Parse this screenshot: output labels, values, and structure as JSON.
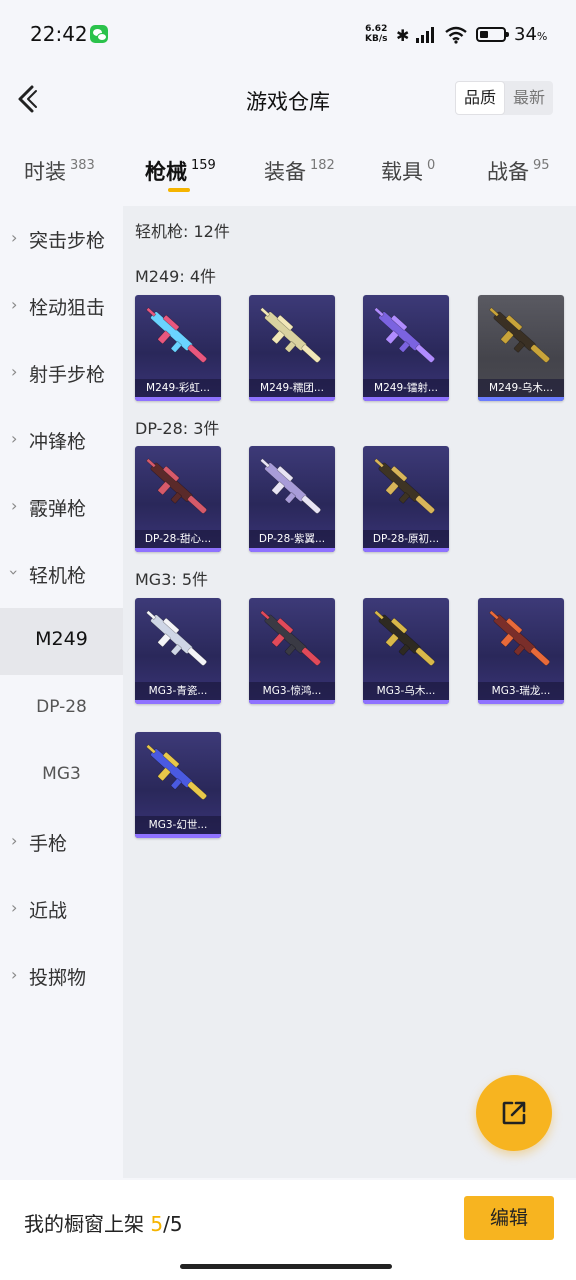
{
  "status": {
    "time": "22:42",
    "net_speed_value": "6.62",
    "net_speed_unit": "KB/s",
    "battery": "34",
    "battery_unit": "%"
  },
  "header": {
    "title": "游戏仓库",
    "sort_options": [
      "品质",
      "最新"
    ],
    "sort_active": "品质"
  },
  "tabs": [
    {
      "label": "时装",
      "count": "383"
    },
    {
      "label": "枪械",
      "count": "159"
    },
    {
      "label": "装备",
      "count": "182"
    },
    {
      "label": "载具",
      "count": "0"
    },
    {
      "label": "战备",
      "count": "95"
    }
  ],
  "active_tab": "枪械",
  "sidebar": {
    "items": [
      {
        "label": "突击步枪",
        "expanded": false
      },
      {
        "label": "栓动狙击",
        "expanded": false
      },
      {
        "label": "射手步枪",
        "expanded": false
      },
      {
        "label": "冲锋枪",
        "expanded": false
      },
      {
        "label": "霰弹枪",
        "expanded": false
      },
      {
        "label": "轻机枪",
        "expanded": true
      },
      {
        "label": "M249",
        "sub": true,
        "active": true
      },
      {
        "label": "DP-28",
        "sub": true
      },
      {
        "label": "MG3",
        "sub": true
      },
      {
        "label": "手枪",
        "expanded": false
      },
      {
        "label": "近战",
        "expanded": false
      },
      {
        "label": "投掷物",
        "expanded": false
      }
    ]
  },
  "content": {
    "category_title": "轻机枪: 12件",
    "groups": [
      {
        "title": "M249: 4件",
        "items": [
          {
            "name": "M249-彩虹...",
            "accent": "#e8577e",
            "body": "#6ad3ff",
            "grey": false
          },
          {
            "name": "M249-糯团...",
            "accent": "#f1e7b8",
            "body": "#d9d2a0",
            "grey": false
          },
          {
            "name": "M249-镭射...",
            "accent": "#b08cff",
            "body": "#7b63e0",
            "grey": false
          },
          {
            "name": "M249-乌木...",
            "accent": "#c9a43a",
            "body": "#3a3024",
            "grey": true
          }
        ]
      },
      {
        "title": "DP-28: 3件",
        "items": [
          {
            "name": "DP-28-甜心...",
            "accent": "#d65a6a",
            "body": "#5a2a2a",
            "grey": false
          },
          {
            "name": "DP-28-紫翼...",
            "accent": "#e8e4f4",
            "body": "#a89cd8",
            "grey": false
          },
          {
            "name": "DP-28-原初...",
            "accent": "#d8b55a",
            "body": "#3e3424",
            "grey": false
          }
        ]
      },
      {
        "title": "MG3: 5件",
        "items": [
          {
            "name": "MG3-青瓷...",
            "accent": "#f4f4f8",
            "body": "#cfd6e6",
            "grey": false
          },
          {
            "name": "MG3-惊鸿...",
            "accent": "#e04a5a",
            "body": "#3a3a44",
            "grey": false
          },
          {
            "name": "MG3-乌木...",
            "accent": "#d9b84a",
            "body": "#2e2a22",
            "grey": false
          },
          {
            "name": "MG3-瑞龙...",
            "accent": "#e86a3a",
            "body": "#7a2e2a",
            "grey": false
          },
          {
            "name": "MG3-幻世...",
            "accent": "#e8c84a",
            "body": "#4a5ae0",
            "grey": false
          }
        ]
      }
    ]
  },
  "bottom": {
    "showcase_label": "我的橱窗上架",
    "showcase_current": "5",
    "showcase_total": "/5",
    "edit_label": "编辑"
  }
}
